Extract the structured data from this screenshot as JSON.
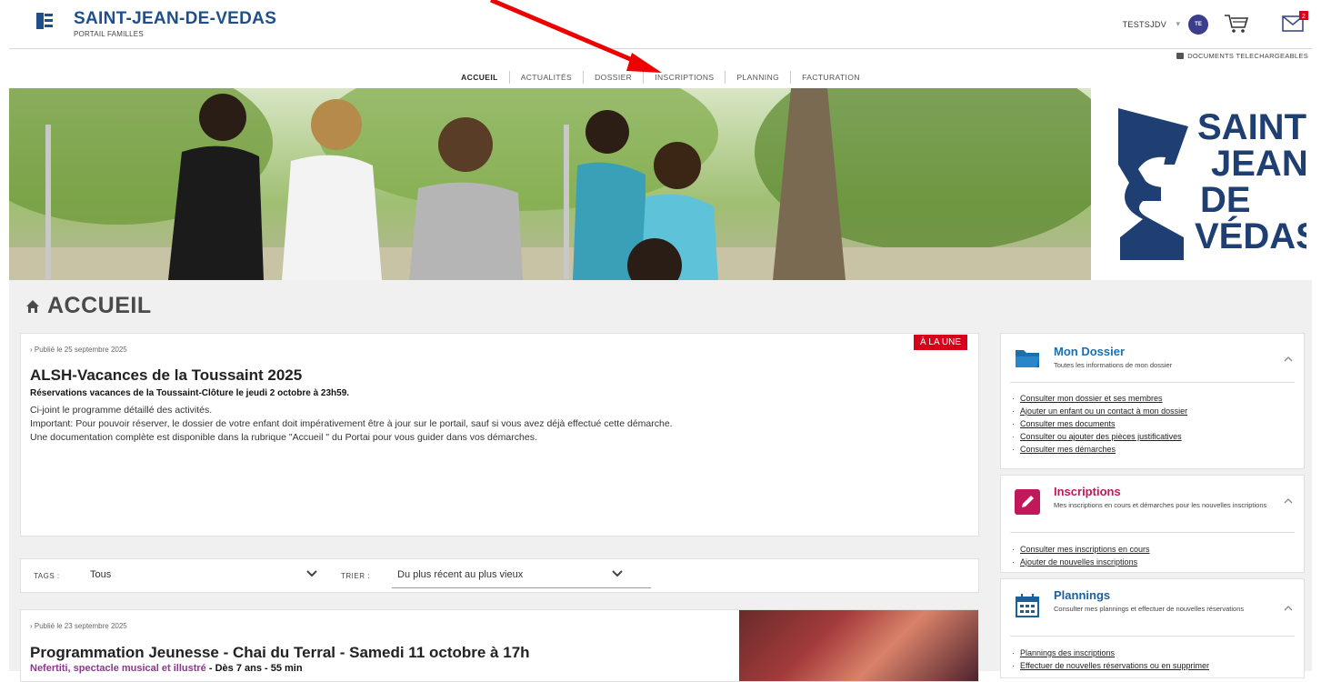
{
  "header": {
    "brand_title": "SAINT-JEAN-DE-VEDAS",
    "brand_subtitle": "PORTAIL FAMILLES",
    "user_name": "TESTSJDV",
    "avatar_initials": "TE",
    "mail_count": "2",
    "docs_link": "DOCUMENTS TELECHARGEABLES"
  },
  "nav": {
    "items": [
      {
        "label": "ACCUEIL"
      },
      {
        "label": "ACTUALITÉS"
      },
      {
        "label": "DOSSIER"
      },
      {
        "label": "INSCRIPTIONS"
      },
      {
        "label": "PLANNING"
      },
      {
        "label": "FACTURATION"
      }
    ],
    "active": "ACCUEIL"
  },
  "banner": {
    "logo_lines": [
      "SAINT",
      "JEAN",
      "DE",
      "VÉDAS"
    ]
  },
  "page": {
    "heading": "ACCUEIL"
  },
  "article1": {
    "date": "Publié le 25 septembre 2025",
    "badge": "À LA UNE",
    "title": "ALSH-Vacances de la Toussaint 2025",
    "subtitle": "Réservations vacances de la Toussaint-Clôture le jeudi 2 octobre à 23h59.",
    "lines": [
      "Ci-joint le programme détaillé des activités.",
      "Important: Pour pouvoir réserver, le dossier de votre enfant doit impérativement être à jour sur le portail, sauf si vous avez déjà effectué cette démarche.",
      "Une documentation complète est disponible dans la rubrique \"Accueil \" du Portai pour vous guider dans vos démarches."
    ]
  },
  "filters": {
    "tags_label": "TAGS :",
    "tags_value": "Tous",
    "sort_label": "TRIER :",
    "sort_value": "Du plus récent au plus vieux"
  },
  "article2": {
    "date": "Publié le 23 septembre 2025",
    "title": "Programmation Jeunesse - Chai du Terral - Samedi 11 octobre à 17h",
    "subtitle_a": "Nefertiti, spectacle musical et illustré",
    "subtitle_b": " - Dès 7 ans - 55 min"
  },
  "sidebar": {
    "dossier": {
      "title": "Mon Dossier",
      "desc": "Toutes les informations de mon dossier",
      "links": [
        "Consulter mon dossier et ses membres",
        "Ajouter un enfant ou un contact à mon dossier",
        "Consulter mes documents",
        "Consulter ou ajouter des pièces justificatives",
        "Consulter mes démarches"
      ]
    },
    "inscriptions": {
      "title": "Inscriptions",
      "desc": "Mes inscriptions en cours et démarches pour les nouvelles inscriptions",
      "links": [
        "Consulter mes inscriptions en cours",
        "Ajouter de nouvelles inscriptions"
      ]
    },
    "plannings": {
      "title": "Plannings",
      "desc": "Consulter mes plannings et effectuer de nouvelles réservations",
      "links": [
        "Plannings des inscriptions",
        "Effectuer de nouvelles réservations ou en supprimer"
      ]
    }
  },
  "colors": {
    "brand_blue": "#1f4f8a",
    "badge_red": "#d7001a",
    "dossier_blue": "#1a6fb0",
    "inscriptions_pink": "#c2185b",
    "plannings_blue": "#1a5f9e"
  }
}
